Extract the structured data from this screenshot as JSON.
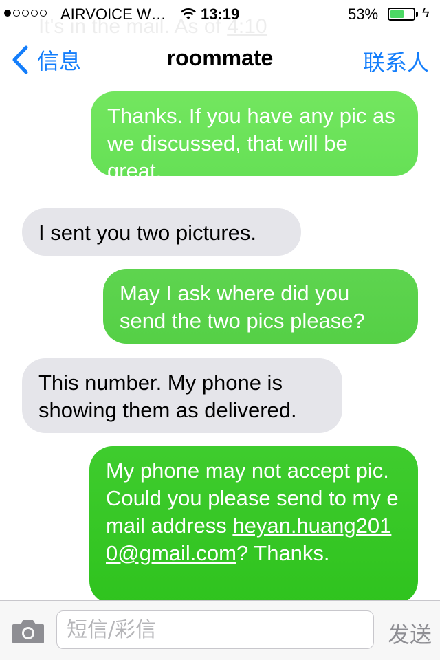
{
  "statusbar": {
    "carrier": "AIRVOICE W…",
    "time": "13:19",
    "battery_percent": "53%",
    "battery_level": 0.53
  },
  "ghost": {
    "text": "It's in the mail. As of ",
    "time": "4:10"
  },
  "navbar": {
    "back_label": "信息",
    "title": "roommate",
    "contact_label": "联系人"
  },
  "messages": [
    {
      "direction": "sent",
      "text": "Thanks. If you have any pic as we discussed, that will be great."
    },
    {
      "direction": "received",
      "text": "I sent you two pictures."
    },
    {
      "direction": "sent",
      "text": "May I ask where did you send the two pics please?"
    },
    {
      "direction": "received",
      "text": "This number. My phone is showing them as delivered."
    },
    {
      "direction": "sent",
      "text_before": "My phone may not accept pic. Could you please send to my email address ",
      "email": "heyan.huang2010@gmail.com",
      "text_after": "? Thanks."
    }
  ],
  "input": {
    "placeholder": "短信/彩信",
    "send_label": "发送"
  },
  "colors": {
    "accent": "#147efb",
    "sent_bubble": "#4cd964",
    "received_bubble": "#e5e5ea"
  },
  "icons": {
    "back": "chevron-left-icon",
    "camera": "camera-icon",
    "wifi": "wifi-icon",
    "charging": "bolt-icon"
  }
}
